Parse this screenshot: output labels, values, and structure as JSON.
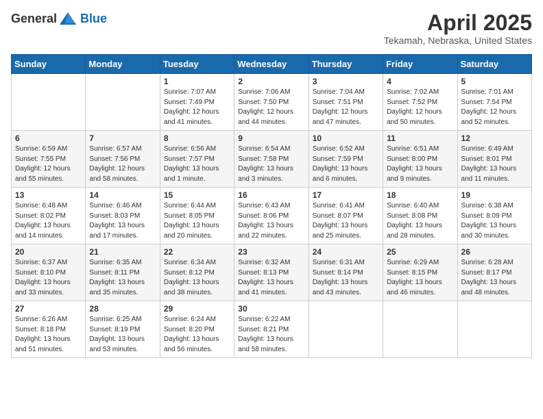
{
  "logo": {
    "general": "General",
    "blue": "Blue"
  },
  "title": "April 2025",
  "location": "Tekamah, Nebraska, United States",
  "weekdays": [
    "Sunday",
    "Monday",
    "Tuesday",
    "Wednesday",
    "Thursday",
    "Friday",
    "Saturday"
  ],
  "weeks": [
    [
      {
        "day": "",
        "sunrise": "",
        "sunset": "",
        "daylight": ""
      },
      {
        "day": "",
        "sunrise": "",
        "sunset": "",
        "daylight": ""
      },
      {
        "day": "1",
        "sunrise": "Sunrise: 7:07 AM",
        "sunset": "Sunset: 7:49 PM",
        "daylight": "Daylight: 12 hours and 41 minutes."
      },
      {
        "day": "2",
        "sunrise": "Sunrise: 7:06 AM",
        "sunset": "Sunset: 7:50 PM",
        "daylight": "Daylight: 12 hours and 44 minutes."
      },
      {
        "day": "3",
        "sunrise": "Sunrise: 7:04 AM",
        "sunset": "Sunset: 7:51 PM",
        "daylight": "Daylight: 12 hours and 47 minutes."
      },
      {
        "day": "4",
        "sunrise": "Sunrise: 7:02 AM",
        "sunset": "Sunset: 7:52 PM",
        "daylight": "Daylight: 12 hours and 50 minutes."
      },
      {
        "day": "5",
        "sunrise": "Sunrise: 7:01 AM",
        "sunset": "Sunset: 7:54 PM",
        "daylight": "Daylight: 12 hours and 52 minutes."
      }
    ],
    [
      {
        "day": "6",
        "sunrise": "Sunrise: 6:59 AM",
        "sunset": "Sunset: 7:55 PM",
        "daylight": "Daylight: 12 hours and 55 minutes."
      },
      {
        "day": "7",
        "sunrise": "Sunrise: 6:57 AM",
        "sunset": "Sunset: 7:56 PM",
        "daylight": "Daylight: 12 hours and 58 minutes."
      },
      {
        "day": "8",
        "sunrise": "Sunrise: 6:56 AM",
        "sunset": "Sunset: 7:57 PM",
        "daylight": "Daylight: 13 hours and 1 minute."
      },
      {
        "day": "9",
        "sunrise": "Sunrise: 6:54 AM",
        "sunset": "Sunset: 7:58 PM",
        "daylight": "Daylight: 13 hours and 3 minutes."
      },
      {
        "day": "10",
        "sunrise": "Sunrise: 6:52 AM",
        "sunset": "Sunset: 7:59 PM",
        "daylight": "Daylight: 13 hours and 6 minutes."
      },
      {
        "day": "11",
        "sunrise": "Sunrise: 6:51 AM",
        "sunset": "Sunset: 8:00 PM",
        "daylight": "Daylight: 13 hours and 9 minutes."
      },
      {
        "day": "12",
        "sunrise": "Sunrise: 6:49 AM",
        "sunset": "Sunset: 8:01 PM",
        "daylight": "Daylight: 13 hours and 11 minutes."
      }
    ],
    [
      {
        "day": "13",
        "sunrise": "Sunrise: 6:48 AM",
        "sunset": "Sunset: 8:02 PM",
        "daylight": "Daylight: 13 hours and 14 minutes."
      },
      {
        "day": "14",
        "sunrise": "Sunrise: 6:46 AM",
        "sunset": "Sunset: 8:03 PM",
        "daylight": "Daylight: 13 hours and 17 minutes."
      },
      {
        "day": "15",
        "sunrise": "Sunrise: 6:44 AM",
        "sunset": "Sunset: 8:05 PM",
        "daylight": "Daylight: 13 hours and 20 minutes."
      },
      {
        "day": "16",
        "sunrise": "Sunrise: 6:43 AM",
        "sunset": "Sunset: 8:06 PM",
        "daylight": "Daylight: 13 hours and 22 minutes."
      },
      {
        "day": "17",
        "sunrise": "Sunrise: 6:41 AM",
        "sunset": "Sunset: 8:07 PM",
        "daylight": "Daylight: 13 hours and 25 minutes."
      },
      {
        "day": "18",
        "sunrise": "Sunrise: 6:40 AM",
        "sunset": "Sunset: 8:08 PM",
        "daylight": "Daylight: 13 hours and 28 minutes."
      },
      {
        "day": "19",
        "sunrise": "Sunrise: 6:38 AM",
        "sunset": "Sunset: 8:09 PM",
        "daylight": "Daylight: 13 hours and 30 minutes."
      }
    ],
    [
      {
        "day": "20",
        "sunrise": "Sunrise: 6:37 AM",
        "sunset": "Sunset: 8:10 PM",
        "daylight": "Daylight: 13 hours and 33 minutes."
      },
      {
        "day": "21",
        "sunrise": "Sunrise: 6:35 AM",
        "sunset": "Sunset: 8:11 PM",
        "daylight": "Daylight: 13 hours and 35 minutes."
      },
      {
        "day": "22",
        "sunrise": "Sunrise: 6:34 AM",
        "sunset": "Sunset: 8:12 PM",
        "daylight": "Daylight: 13 hours and 38 minutes."
      },
      {
        "day": "23",
        "sunrise": "Sunrise: 6:32 AM",
        "sunset": "Sunset: 8:13 PM",
        "daylight": "Daylight: 13 hours and 41 minutes."
      },
      {
        "day": "24",
        "sunrise": "Sunrise: 6:31 AM",
        "sunset": "Sunset: 8:14 PM",
        "daylight": "Daylight: 13 hours and 43 minutes."
      },
      {
        "day": "25",
        "sunrise": "Sunrise: 6:29 AM",
        "sunset": "Sunset: 8:15 PM",
        "daylight": "Daylight: 13 hours and 46 minutes."
      },
      {
        "day": "26",
        "sunrise": "Sunrise: 6:28 AM",
        "sunset": "Sunset: 8:17 PM",
        "daylight": "Daylight: 13 hours and 48 minutes."
      }
    ],
    [
      {
        "day": "27",
        "sunrise": "Sunrise: 6:26 AM",
        "sunset": "Sunset: 8:18 PM",
        "daylight": "Daylight: 13 hours and 51 minutes."
      },
      {
        "day": "28",
        "sunrise": "Sunrise: 6:25 AM",
        "sunset": "Sunset: 8:19 PM",
        "daylight": "Daylight: 13 hours and 53 minutes."
      },
      {
        "day": "29",
        "sunrise": "Sunrise: 6:24 AM",
        "sunset": "Sunset: 8:20 PM",
        "daylight": "Daylight: 13 hours and 56 minutes."
      },
      {
        "day": "30",
        "sunrise": "Sunrise: 6:22 AM",
        "sunset": "Sunset: 8:21 PM",
        "daylight": "Daylight: 13 hours and 58 minutes."
      },
      {
        "day": "",
        "sunrise": "",
        "sunset": "",
        "daylight": ""
      },
      {
        "day": "",
        "sunrise": "",
        "sunset": "",
        "daylight": ""
      },
      {
        "day": "",
        "sunrise": "",
        "sunset": "",
        "daylight": ""
      }
    ]
  ]
}
